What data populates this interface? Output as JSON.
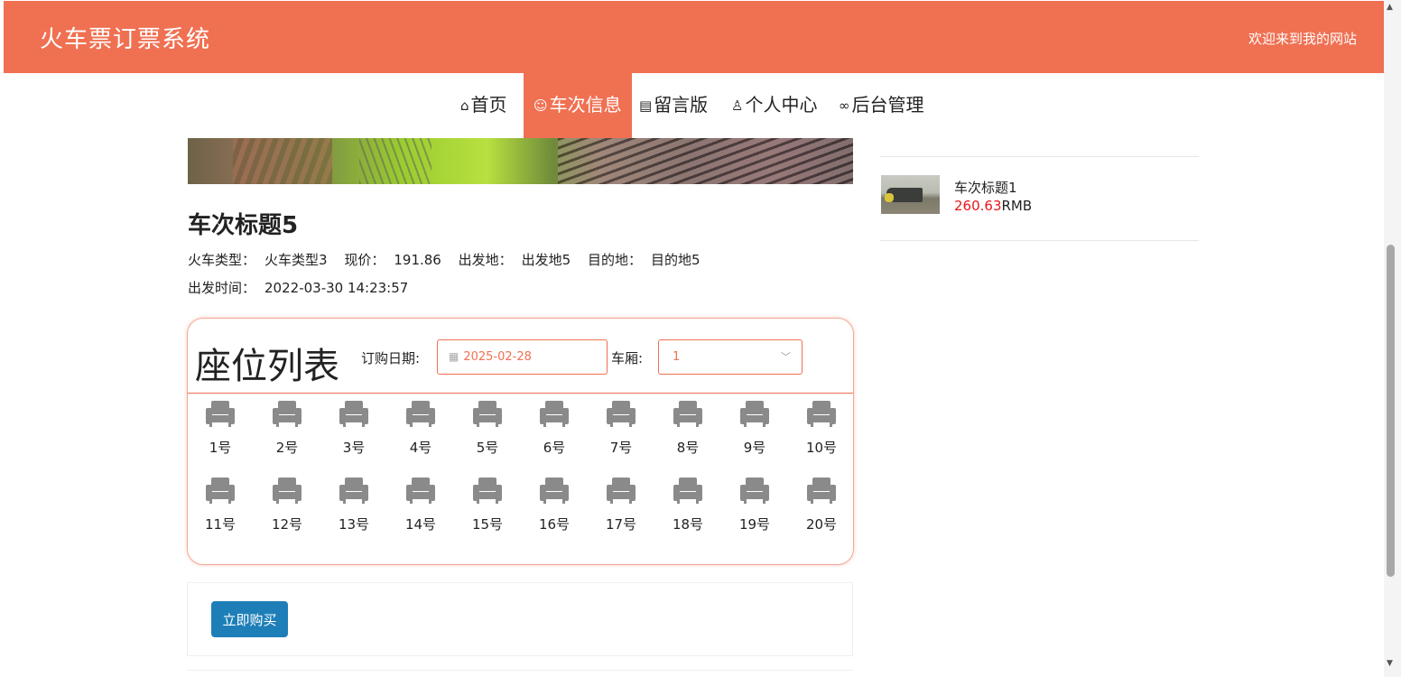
{
  "header": {
    "site_title": "火车票订票系统",
    "welcome": "欢迎来到我的网站"
  },
  "nav": {
    "items": [
      {
        "label": "首页",
        "icon": "home-icon"
      },
      {
        "label": "车次信息",
        "icon": "smile-icon",
        "active": true
      },
      {
        "label": "留言版",
        "icon": "calendar-icon"
      },
      {
        "label": "个人中心",
        "icon": "user-icon"
      },
      {
        "label": "后台管理",
        "icon": "link-icon"
      }
    ]
  },
  "train": {
    "title": "车次标题5",
    "type_label": "火车类型：",
    "type_value": "火车类型3",
    "price_label": "现价：",
    "price_value": "191.86",
    "origin_label": "出发地：",
    "origin_value": "出发地5",
    "destination_label": "目的地：",
    "destination_value": "目的地5",
    "departure_label": "出发时间：",
    "departure_value": "2022-03-30 14:23:57"
  },
  "seat_panel": {
    "heading": "座位列表",
    "date_label": "订购日期:",
    "date_value": "2025-02-28",
    "car_label": "车厢:",
    "car_value": "1",
    "seats": [
      "1号",
      "2号",
      "3号",
      "4号",
      "5号",
      "6号",
      "7号",
      "8号",
      "9号",
      "10号",
      "11号",
      "12号",
      "13号",
      "14号",
      "15号",
      "16号",
      "17号",
      "18号",
      "19号",
      "20号"
    ]
  },
  "actions": {
    "buy_label": "立即购买"
  },
  "sidebar": {
    "item_title": "车次标题1",
    "item_price": "260.63",
    "item_unit": "RMB"
  },
  "colors": {
    "accent": "#f07052",
    "button": "#1e7fb8",
    "price": "#e8171b"
  }
}
